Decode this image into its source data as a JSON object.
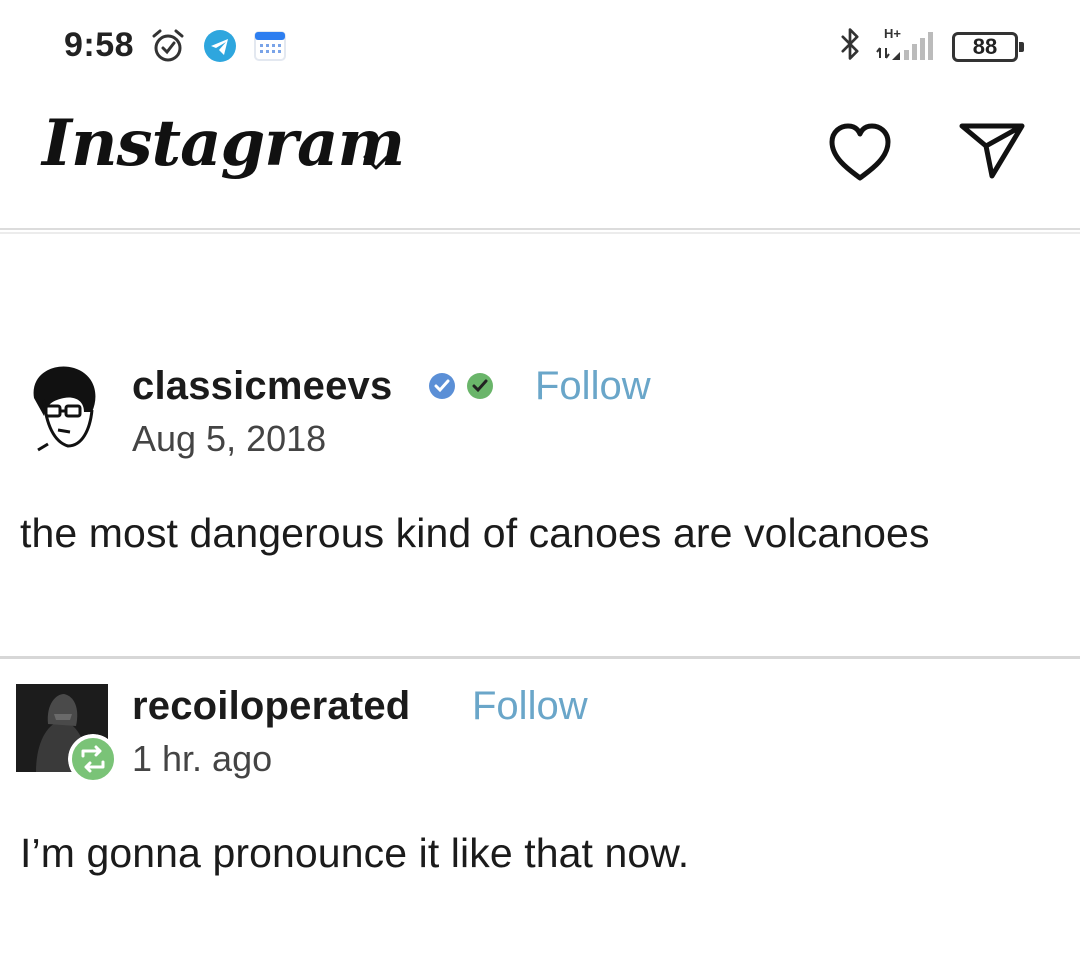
{
  "status_bar": {
    "time": "9:58",
    "network": "H+",
    "battery": "88",
    "icons": [
      "alarm-icon",
      "telegram-icon",
      "calendar-icon",
      "bluetooth-icon",
      "signal-icon",
      "battery-icon"
    ]
  },
  "header": {
    "app_name": "Instagram",
    "icons": [
      "chevron-down-icon",
      "heart-icon",
      "send-icon"
    ]
  },
  "posts": [
    {
      "username": "classicmeevs",
      "follow_label": "Follow",
      "date": "Aug 5, 2018",
      "text": "the most dangerous kind of canoes are volcanoes"
    },
    {
      "username": "recoiloperated",
      "follow_label": "Follow",
      "date": "1 hr. ago",
      "text": "I’m gonna pronounce it like that now."
    }
  ],
  "colors": {
    "follow": "#6aa6c9",
    "verified_blue": "#5b8fd6",
    "verified_green": "#6ab56a",
    "reblog_green": "#7ac377"
  }
}
